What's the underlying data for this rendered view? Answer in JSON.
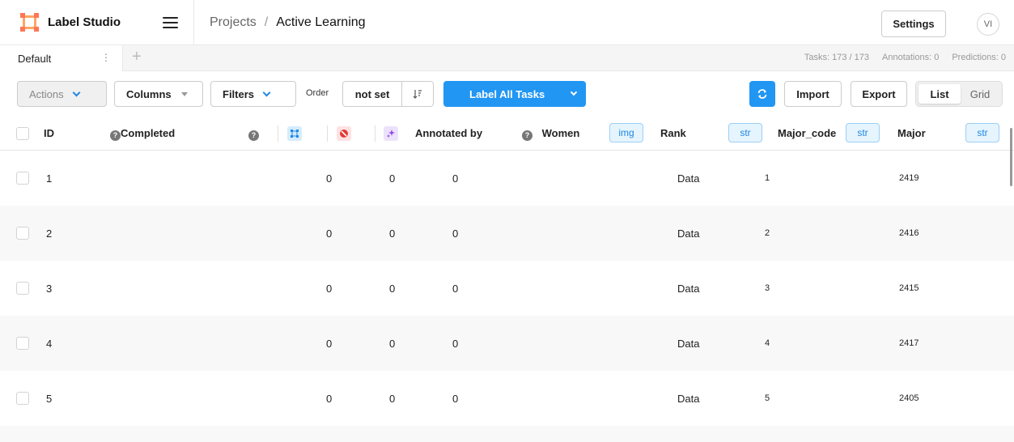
{
  "header": {
    "app_name": "Label Studio",
    "breadcrumb": {
      "projects": "Projects",
      "separator": "/",
      "current": "Active Learning"
    },
    "settings_label": "Settings",
    "avatar_initials": "VI"
  },
  "tabs": {
    "items": [
      {
        "label": "Default"
      }
    ],
    "stats": {
      "tasks": "Tasks: 173 / 173",
      "annotations": "Annotations: 0",
      "predictions": "Predictions: 0"
    }
  },
  "toolbar": {
    "actions_label": "Actions",
    "columns_label": "Columns",
    "filters_label": "Filters",
    "order_label": "Order",
    "order_value": "not set",
    "label_all_label": "Label All Tasks",
    "import_label": "Import",
    "export_label": "Export",
    "view_list": "List",
    "view_grid": "Grid"
  },
  "colors": {
    "primary": "#2196f3",
    "logo_orange": "#ffa663",
    "logo_red": "#ff7557"
  },
  "table": {
    "columns": {
      "id": "ID",
      "completed": "Completed",
      "annotated_by": "Annotated by",
      "women": "Women",
      "women_type": "img",
      "rank": "Rank",
      "rank_type": "str",
      "major_code": "Major_code",
      "major_code_type": "str",
      "major": "Major",
      "major_type": "str"
    },
    "rows": [
      {
        "id": "1",
        "total": "0",
        "cancelled": "0",
        "predictions": "0",
        "women": "Data",
        "rank": "1",
        "major_code": "2419"
      },
      {
        "id": "2",
        "total": "0",
        "cancelled": "0",
        "predictions": "0",
        "women": "Data",
        "rank": "2",
        "major_code": "2416"
      },
      {
        "id": "3",
        "total": "0",
        "cancelled": "0",
        "predictions": "0",
        "women": "Data",
        "rank": "3",
        "major_code": "2415"
      },
      {
        "id": "4",
        "total": "0",
        "cancelled": "0",
        "predictions": "0",
        "women": "Data",
        "rank": "4",
        "major_code": "2417"
      },
      {
        "id": "5",
        "total": "0",
        "cancelled": "0",
        "predictions": "0",
        "women": "Data",
        "rank": "5",
        "major_code": "2405"
      }
    ]
  }
}
